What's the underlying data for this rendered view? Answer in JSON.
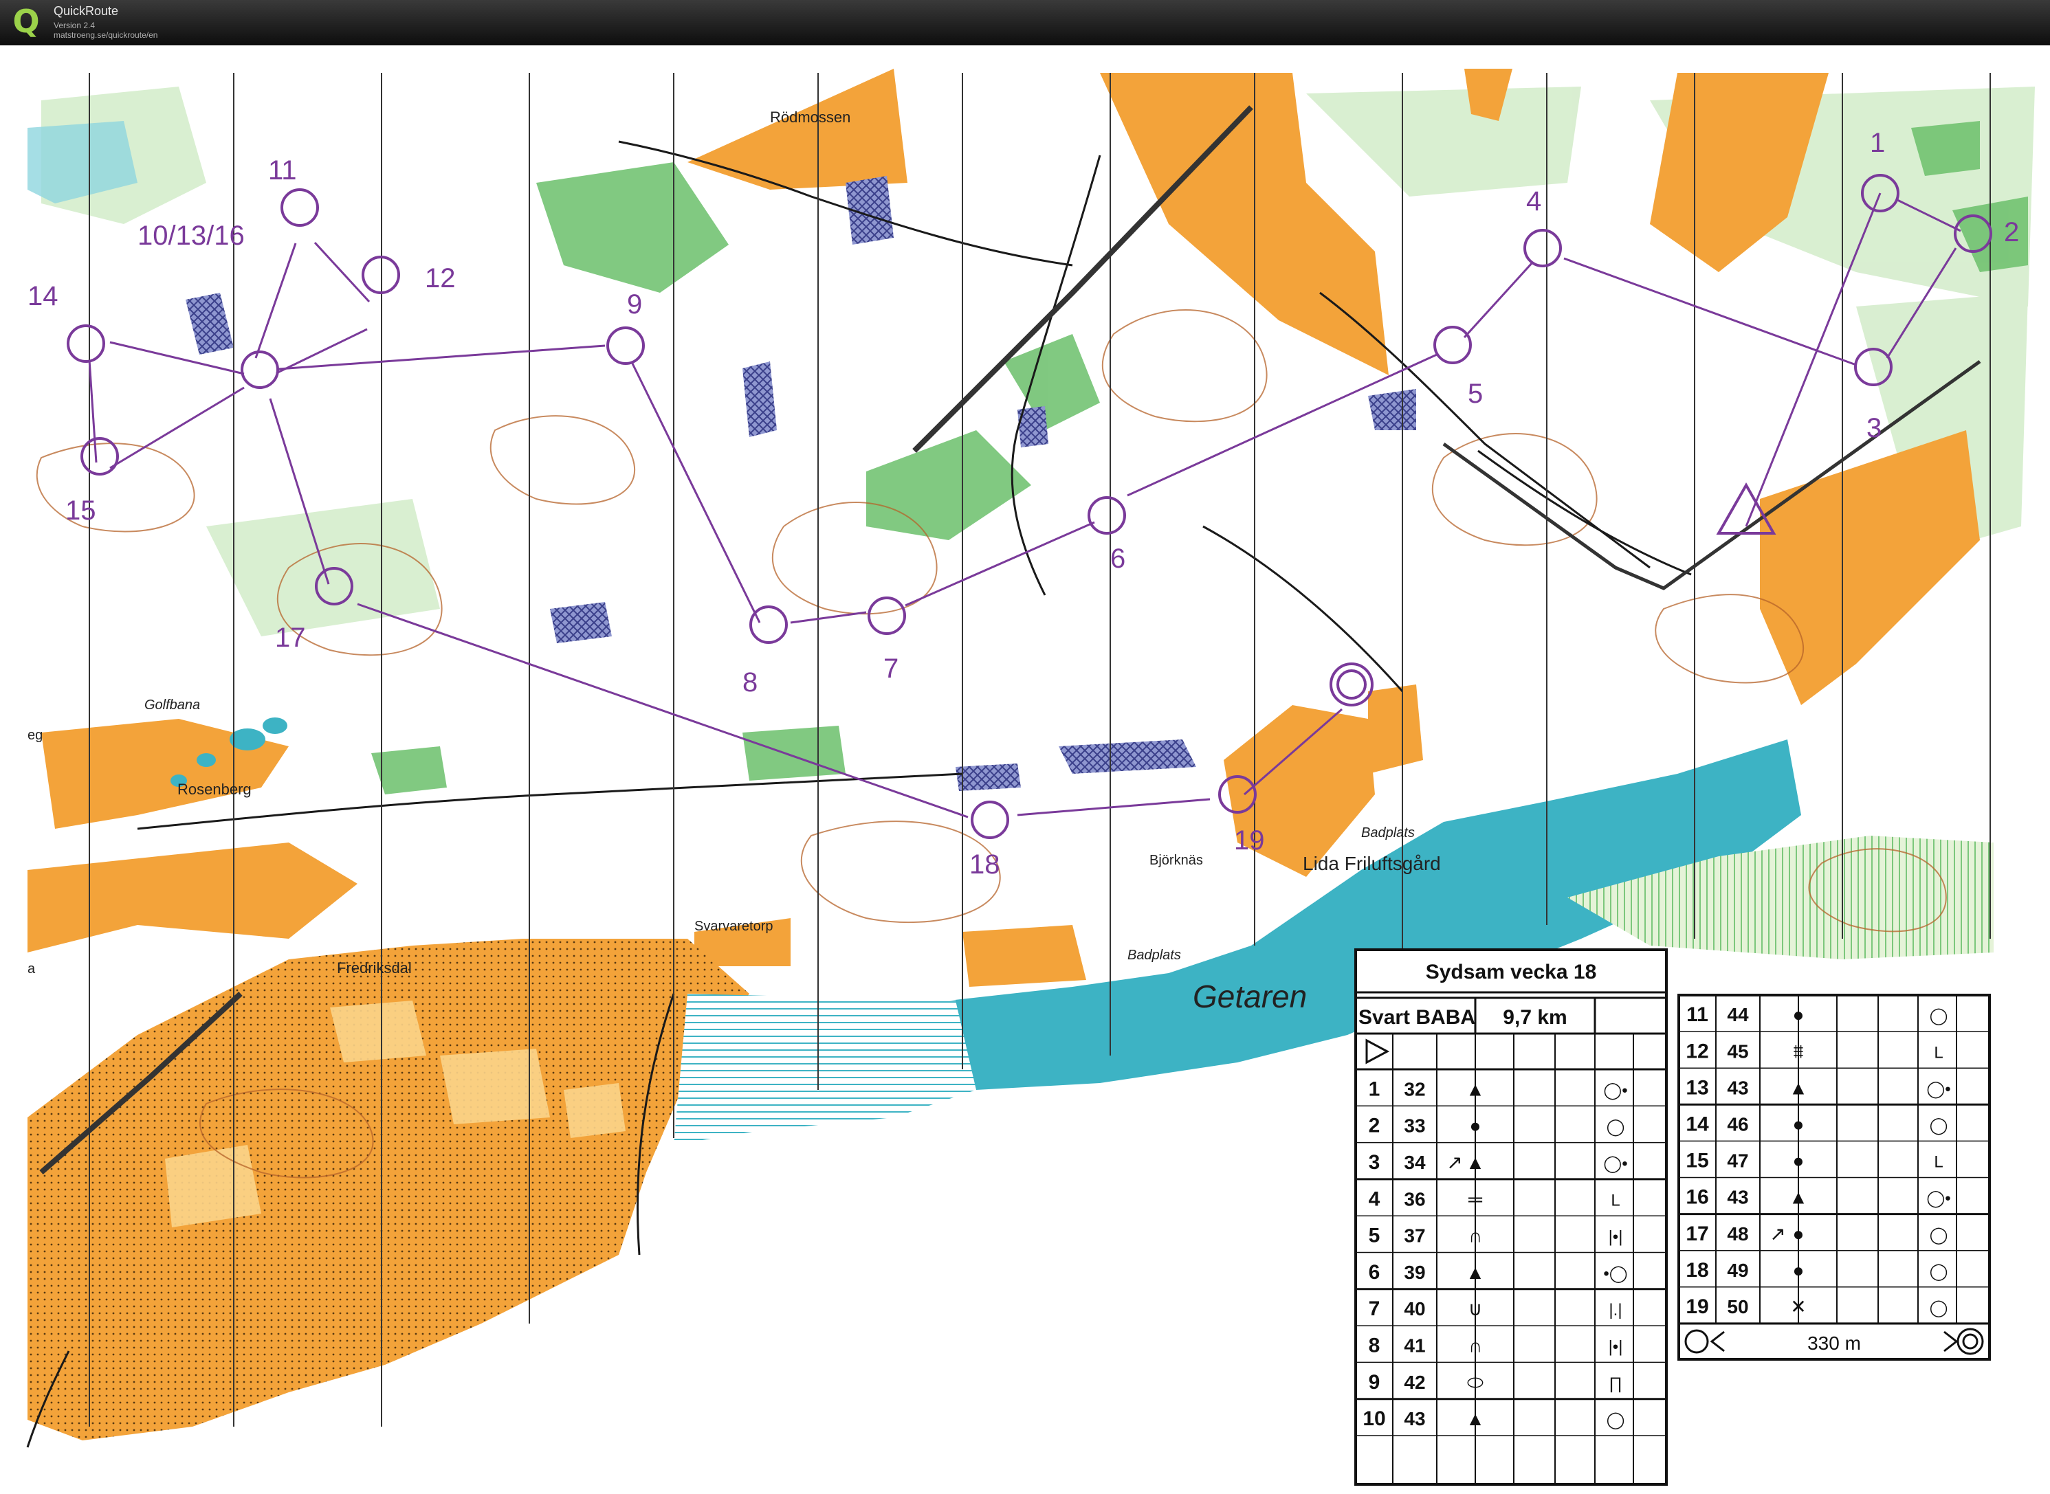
{
  "app": {
    "name": "QuickRoute",
    "version": "Version 2.4",
    "url": "matstroeng.se/quickroute/en",
    "logo_icon": "quickroute-q-logo-icon"
  },
  "colors": {
    "open": "#f3a33a",
    "rough": "#fbd48a",
    "water": "#3db3c4",
    "forest_green": "#6bbf6b",
    "light_green": "#c8e8c0",
    "course": "#7a3a9a",
    "contour": "#b5632a",
    "marsh": "#5a6bb0"
  },
  "map_labels": {
    "rodmossen": "Rödmossen",
    "golfbana": "Golfbana",
    "rosenberg": "Rosenberg",
    "fredriksdal": "Fredriksdal",
    "svarvaretorp": "Svarvaretorp",
    "bjorknas": "Björknäs",
    "badplats1": "Badplats",
    "badplats2": "Badplats",
    "lida": "Lida Friluftsgård",
    "getaren": "Getaren",
    "edge_left1": "eg",
    "edge_left2": "a"
  },
  "course": {
    "controls": [
      {
        "label": "1"
      },
      {
        "label": "2"
      },
      {
        "label": "3"
      },
      {
        "label": "4"
      },
      {
        "label": "5"
      },
      {
        "label": "6"
      },
      {
        "label": "7"
      },
      {
        "label": "8"
      },
      {
        "label": "9"
      },
      {
        "label": "10/13/16"
      },
      {
        "label": "11"
      },
      {
        "label": "12"
      },
      {
        "label": "14"
      },
      {
        "label": "15"
      },
      {
        "label": "17"
      },
      {
        "label": "18"
      },
      {
        "label": "19"
      }
    ]
  },
  "description_sheet": {
    "title": "Sydsam vecka 18",
    "class_name": "Svart BABA",
    "length": "9,7 km",
    "start_symbol": "start-triangle-icon",
    "rows_left": [
      {
        "num": "1",
        "code": "32",
        "dir": "",
        "feature": "▲",
        "appearance": "◯•"
      },
      {
        "num": "2",
        "code": "33",
        "dir": "",
        "feature": "●",
        "appearance": "◯"
      },
      {
        "num": "3",
        "code": "34",
        "dir": "↗",
        "feature": "▲",
        "appearance": "◯•"
      },
      {
        "num": "4",
        "code": "36",
        "dir": "",
        "feature": "╤",
        "appearance": "L"
      },
      {
        "num": "5",
        "code": "37",
        "dir": "",
        "feature": "∩",
        "appearance": "|•|"
      },
      {
        "num": "6",
        "code": "39",
        "dir": "",
        "feature": "▲",
        "appearance": "•◯"
      },
      {
        "num": "7",
        "code": "40",
        "dir": "",
        "feature": "∪",
        "appearance": "|.|"
      },
      {
        "num": "8",
        "code": "41",
        "dir": "",
        "feature": "∩",
        "appearance": "|•|"
      },
      {
        "num": "9",
        "code": "42",
        "dir": "",
        "feature": "⬭",
        "appearance": "∏"
      },
      {
        "num": "10",
        "code": "43",
        "dir": "",
        "feature": "▲",
        "appearance": "◯"
      }
    ],
    "rows_right": [
      {
        "num": "11",
        "code": "44",
        "dir": "",
        "feature": "●",
        "appearance": "◯"
      },
      {
        "num": "12",
        "code": "45",
        "dir": "",
        "feature": "⩩",
        "appearance": "L"
      },
      {
        "num": "13",
        "code": "43",
        "dir": "",
        "feature": "▲",
        "appearance": "◯•"
      },
      {
        "num": "14",
        "code": "46",
        "dir": "",
        "feature": "●",
        "appearance": "◯"
      },
      {
        "num": "15",
        "code": "47",
        "dir": "",
        "feature": "●",
        "appearance": "L"
      },
      {
        "num": "16",
        "code": "43",
        "dir": "",
        "feature": "▲",
        "appearance": "◯•"
      },
      {
        "num": "17",
        "code": "48",
        "dir": "↗",
        "feature": "●",
        "appearance": "◯"
      },
      {
        "num": "18",
        "code": "49",
        "dir": "",
        "feature": "●",
        "appearance": "◯"
      },
      {
        "num": "19",
        "code": "50",
        "dir": "",
        "feature": "✕",
        "appearance": "◯"
      }
    ],
    "finish_distance": "330 m",
    "finish_start_symbol": "funnel-start-icon",
    "finish_end_symbol": "finish-circle-icon"
  }
}
